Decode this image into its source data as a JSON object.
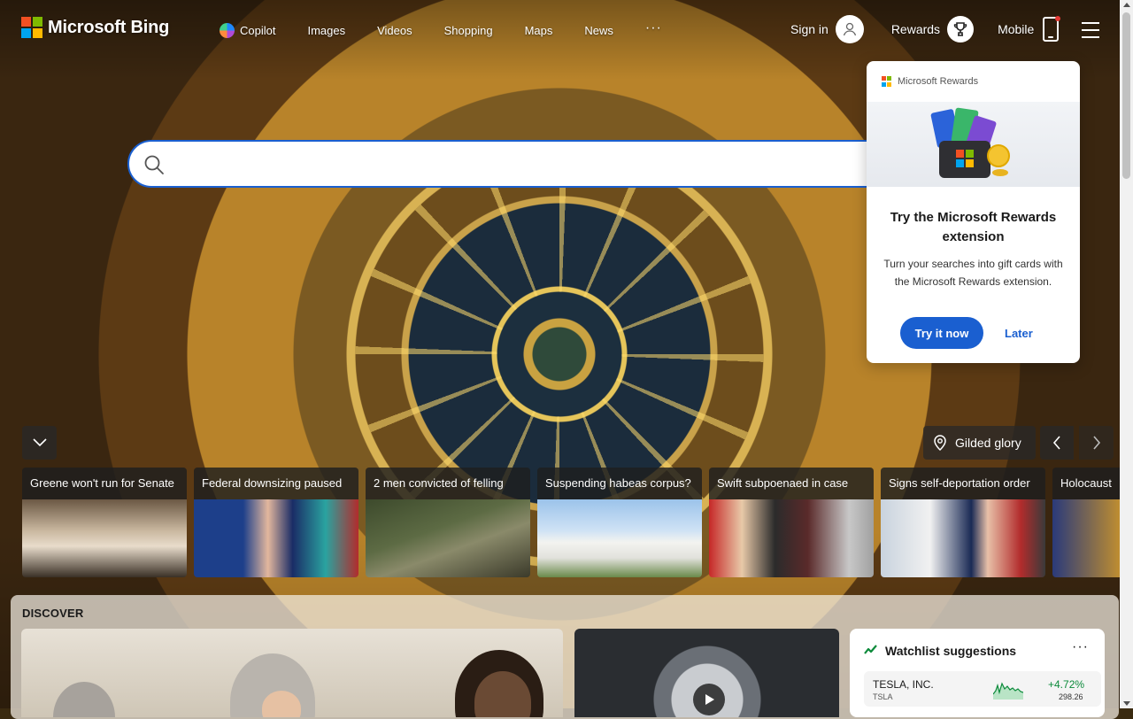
{
  "brand": {
    "name": "Microsoft Bing",
    "logo_colors": [
      "#f25022",
      "#7fba00",
      "#00a4ef",
      "#ffb900"
    ]
  },
  "nav": {
    "items": [
      {
        "label": "Copilot",
        "icon": "copilot-icon"
      },
      {
        "label": "Images"
      },
      {
        "label": "Videos"
      },
      {
        "label": "Shopping"
      },
      {
        "label": "Maps"
      },
      {
        "label": "News"
      }
    ],
    "more_label": "···"
  },
  "account": {
    "sign_in_label": "Sign in",
    "rewards_label": "Rewards",
    "mobile_label": "Mobile"
  },
  "search": {
    "value": "",
    "placeholder": ""
  },
  "rewards_popup": {
    "brand_label": "Microsoft Rewards",
    "title": "Try the Microsoft Rewards extension",
    "body": "Turn your searches into gift cards with the Microsoft Rewards extension.",
    "primary_label": "Try it now",
    "secondary_label": "Later"
  },
  "background": {
    "caption": "Gilded glory"
  },
  "news": [
    {
      "title": "Greene won't run for Senate"
    },
    {
      "title": "Federal downsizing paused"
    },
    {
      "title": "2 men convicted of felling"
    },
    {
      "title": "Suspending habeas corpus?"
    },
    {
      "title": "Swift subpoenaed in case"
    },
    {
      "title": "Signs self-deportation order"
    },
    {
      "title": "Holocaust"
    }
  ],
  "discover": {
    "label": "DISCOVER"
  },
  "watchlist": {
    "title": "Watchlist suggestions",
    "more_label": "···",
    "stocks": [
      {
        "name": "TESLA, INC.",
        "symbol": "TSLA",
        "change": "+4.72%",
        "price": "298.26"
      }
    ]
  },
  "colors": {
    "accent": "#1a5fd0",
    "positive": "#0b8a3a",
    "notification": "#e53935"
  }
}
